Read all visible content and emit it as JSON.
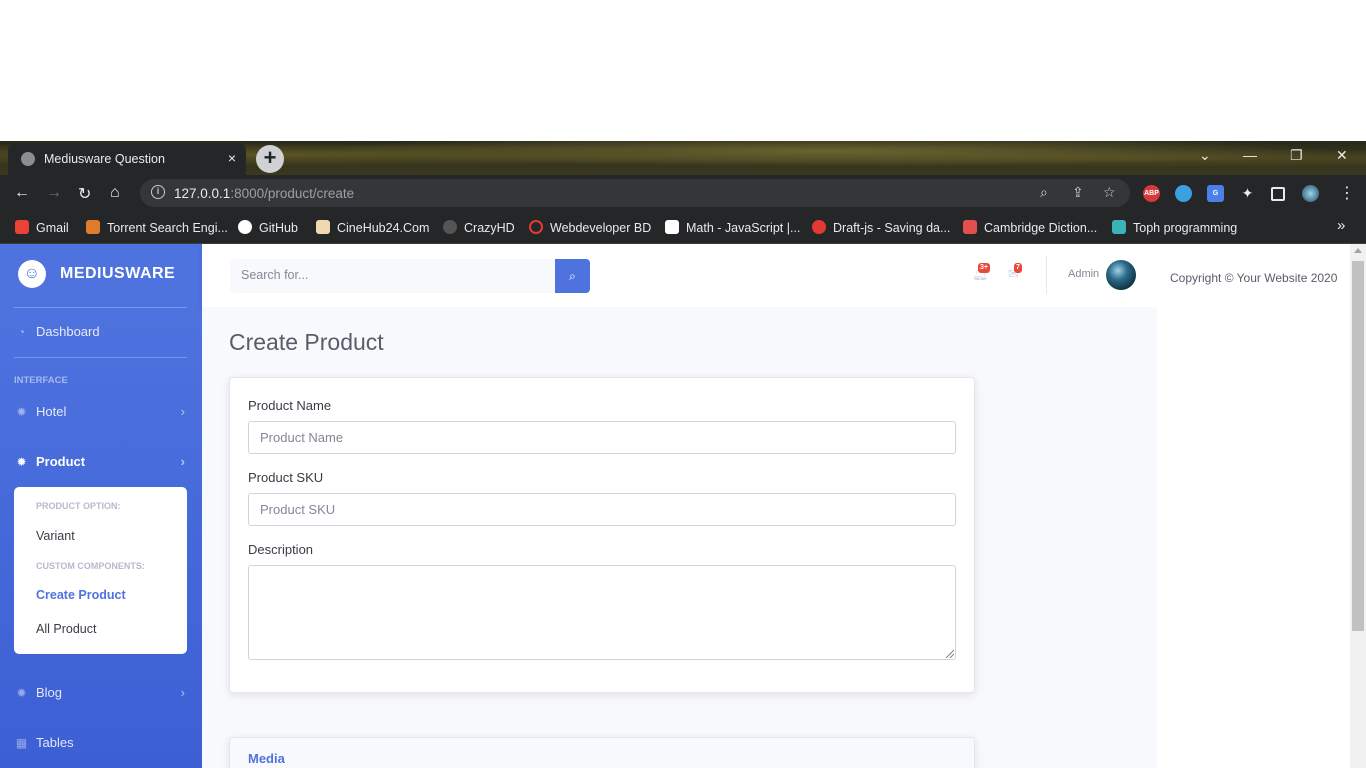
{
  "browser": {
    "tab_title": "Mediusware Question",
    "tab_close": "×",
    "new_tab": "+",
    "window": {
      "minimize": "—",
      "restore": "❐",
      "close": "✕",
      "tab_search": "⌄"
    },
    "url_host": "127.0.0.1",
    "url_path": ":8000/product/create",
    "extensions": [
      "ABP",
      "",
      "G",
      "",
      "",
      ""
    ],
    "bookmarks": [
      {
        "label": "Gmail",
        "color": "#ea4335"
      },
      {
        "label": "Torrent Search Engi...",
        "color": "#e07b2a"
      },
      {
        "label": "GitHub",
        "color": "#ffffff"
      },
      {
        "label": "CineHub24.Com",
        "color": "#f0d8b0"
      },
      {
        "label": "CrazyHD",
        "color": "#555555"
      },
      {
        "label": "Webdeveloper BD",
        "color": "#e53935"
      },
      {
        "label": "Math - JavaScript |...",
        "color": "#ffffff"
      },
      {
        "label": "Draft-js - Saving da...",
        "color": "#e53935"
      },
      {
        "label": "Cambridge Diction...",
        "color": "#e05050"
      },
      {
        "label": "Toph programming",
        "color": "#39b3b7"
      }
    ],
    "bookmarks_more": "»"
  },
  "sidebar": {
    "brand": "MEDIUSWARE",
    "dashboard": "Dashboard",
    "interface_heading": "INTERFACE",
    "hotel": "Hotel",
    "product": "Product",
    "product_menu": {
      "heading_options": "PRODUCT OPTION:",
      "variant": "Variant",
      "heading_custom": "CUSTOM COMPONENTS:",
      "create_product": "Create Product",
      "all_product": "All Product"
    },
    "blog": "Blog",
    "tables": "Tables"
  },
  "topbar": {
    "search_placeholder": "Search for...",
    "alerts_badge": "3+",
    "messages_badge": "7",
    "admin_name": "Admin"
  },
  "main": {
    "page_title": "Create Product",
    "form": {
      "product_name_label": "Product Name",
      "product_name_placeholder": "Product Name",
      "product_sku_label": "Product SKU",
      "product_sku_placeholder": "Product SKU",
      "description_label": "Description"
    },
    "media_title": "Media"
  },
  "right_panel": {
    "copyright": "Copyright © Your Website 2020"
  },
  "colors": {
    "primary": "#4e73df",
    "danger": "#e74a3b"
  }
}
